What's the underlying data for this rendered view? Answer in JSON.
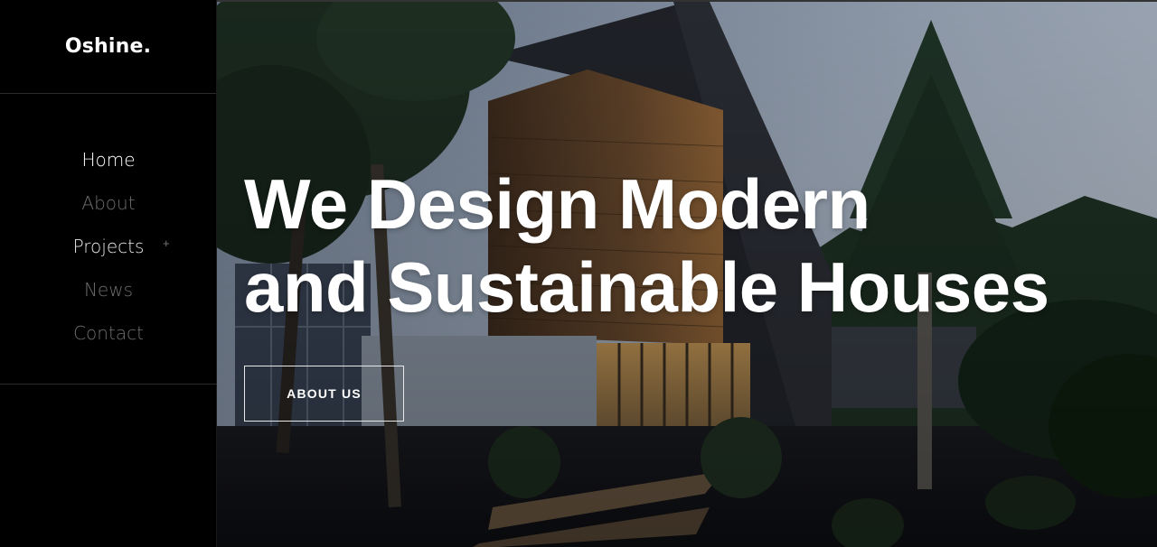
{
  "brand": {
    "logo": "Oshine."
  },
  "nav": {
    "items": [
      {
        "label": "Home"
      },
      {
        "label": "About"
      },
      {
        "label": "Projects",
        "submenu_icon": "+"
      },
      {
        "label": "News"
      },
      {
        "label": "Contact"
      }
    ]
  },
  "hero": {
    "title_line1": "We Design Modern",
    "title_line2": "and Sustainable Houses",
    "button_label": "ABOUT US",
    "background": "modern-house-night-photo"
  },
  "colors": {
    "sidebar_bg": "#000000",
    "text_active": "#ffffff",
    "text_muted": "#6e6e6e"
  }
}
